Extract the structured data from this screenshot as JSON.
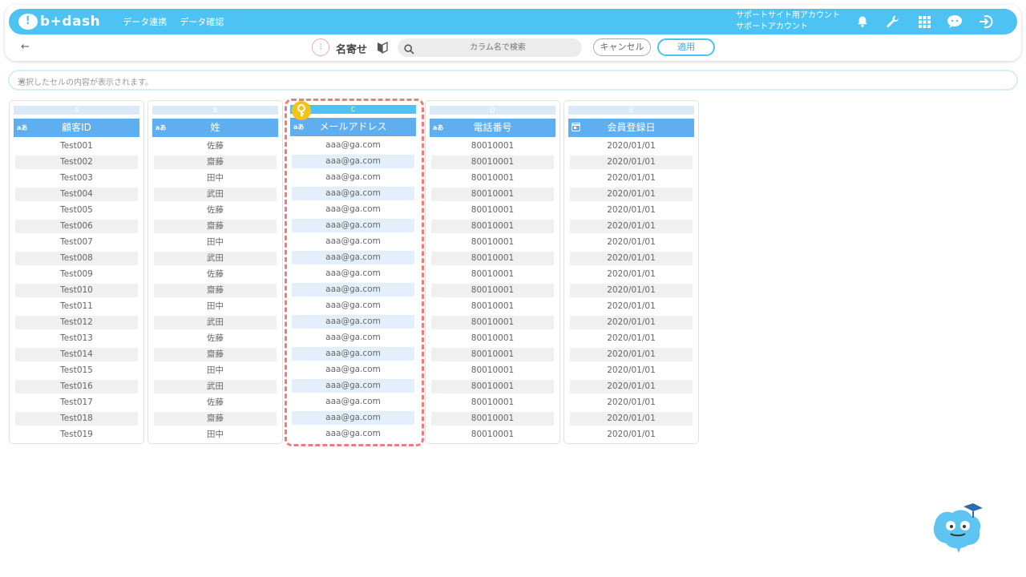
{
  "app": {
    "logo_text": "b+dash",
    "logo_glyph": "!"
  },
  "nav": {
    "data_link": "データ連携",
    "data_check": "データ確認"
  },
  "account": {
    "line1": "サポートサイト用アカウント",
    "line2": "サポートアカウント"
  },
  "toolbar": {
    "back_glyph": "←",
    "merge_glyph": "⫶",
    "title": "名寄せ",
    "search_placeholder": "カラム名で検索",
    "cancel_label": "キャンセル",
    "apply_label": "適用"
  },
  "cell_viewer": {
    "placeholder": "選択したセルの内容が表示されます。",
    "chevron": "⌄"
  },
  "columns": [
    {
      "letter": "A",
      "type": "aあ",
      "name": "顧客ID",
      "zebra": "gray",
      "values": [
        "Test001",
        "Test002",
        "Test003",
        "Test004",
        "Test005",
        "Test006",
        "Test007",
        "Test008",
        "Test009",
        "Test010",
        "Test011",
        "Test012",
        "Test013",
        "Test014",
        "Test015",
        "Test016",
        "Test017",
        "Test018",
        "Test019"
      ]
    },
    {
      "letter": "B",
      "type": "aあ",
      "name": "姓",
      "zebra": "gray",
      "values": [
        "佐藤",
        "齋藤",
        "田中",
        "武田",
        "佐藤",
        "齋藤",
        "田中",
        "武田",
        "佐藤",
        "齋藤",
        "田中",
        "武田",
        "佐藤",
        "齋藤",
        "田中",
        "武田",
        "佐藤",
        "齋藤",
        "田中"
      ]
    },
    {
      "letter": "C",
      "type": "aあ",
      "name": "メールアドレス",
      "zebra": "blue",
      "selected": true,
      "values": [
        "aaa@ga.com",
        "aaa@ga.com",
        "aaa@ga.com",
        "aaa@ga.com",
        "aaa@ga.com",
        "aaa@ga.com",
        "aaa@ga.com",
        "aaa@ga.com",
        "aaa@ga.com",
        "aaa@ga.com",
        "aaa@ga.com",
        "aaa@ga.com",
        "aaa@ga.com",
        "aaa@ga.com",
        "aaa@ga.com",
        "aaa@ga.com",
        "aaa@ga.com",
        "aaa@ga.com",
        "aaa@ga.com"
      ]
    },
    {
      "letter": "D",
      "type": "aあ",
      "name": "電話番号",
      "zebra": "gray",
      "values": [
        "80010001",
        "80010001",
        "80010001",
        "80010001",
        "80010001",
        "80010001",
        "80010001",
        "80010001",
        "80010001",
        "80010001",
        "80010001",
        "80010001",
        "80010001",
        "80010001",
        "80010001",
        "80010001",
        "80010001",
        "80010001",
        "80010001"
      ]
    },
    {
      "letter": "E",
      "type": "calendar",
      "name": "会員登録日",
      "zebra": "gray",
      "values": [
        "2020/01/01",
        "2020/01/01",
        "2020/01/01",
        "2020/01/01",
        "2020/01/01",
        "2020/01/01",
        "2020/01/01",
        "2020/01/01",
        "2020/01/01",
        "2020/01/01",
        "2020/01/01",
        "2020/01/01",
        "2020/01/01",
        "2020/01/01",
        "2020/01/01",
        "2020/01/01",
        "2020/01/01",
        "2020/01/01",
        "2020/01/01"
      ]
    }
  ],
  "colors": {
    "brand": "#4cc3f3",
    "header": "#5eaef0",
    "highlight": "#ef7d7d",
    "key": "#f5c21a"
  }
}
